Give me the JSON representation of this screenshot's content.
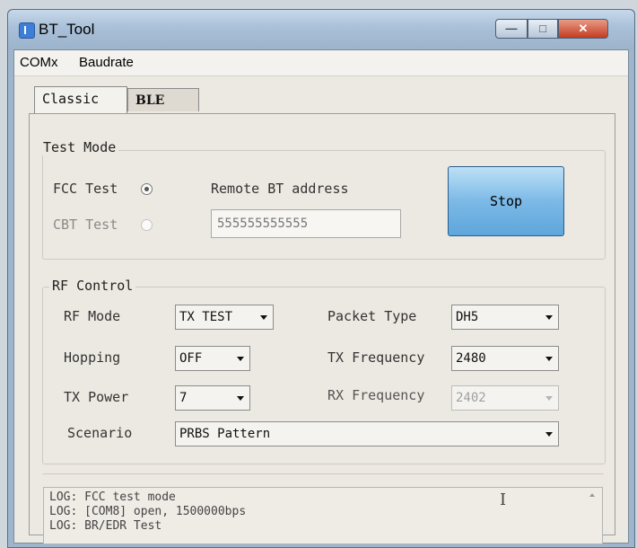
{
  "window": {
    "title": "BT_Tool"
  },
  "menu": {
    "items": [
      "COMx",
      "Baudrate"
    ]
  },
  "tabs": {
    "classic": "Classic",
    "ble": "BLE"
  },
  "test_mode": {
    "title": "Test Mode",
    "fcc_label": "FCC Test",
    "cbt_label": "CBT Test",
    "selected": "FCC Test",
    "remote_label": "Remote BT address",
    "remote_value": "555555555555",
    "stop_label": "Stop"
  },
  "rf_control": {
    "title": "RF Control",
    "rf_mode_label": "RF Mode",
    "rf_mode_value": "TX TEST",
    "packet_type_label": "Packet Type",
    "packet_type_value": "DH5",
    "hopping_label": "Hopping",
    "hopping_value": "OFF",
    "tx_freq_label": "TX Frequency",
    "tx_freq_value": "2480",
    "tx_power_label": "TX Power",
    "tx_power_value": "7",
    "rx_freq_label": "RX Frequency",
    "rx_freq_value": "2402",
    "scenario_label": "Scenario",
    "scenario_value": "PRBS Pattern"
  },
  "log": {
    "lines": [
      "LOG: FCC test mode",
      "LOG: [COM8] open, 1500000bps",
      "LOG: BR/EDR Test"
    ]
  },
  "colors": {
    "stop_button": "#7cb9e6",
    "close_button": "#c33d22"
  },
  "icons": {
    "app": "bluetooth-app-icon",
    "minimize": "minimize-icon",
    "maximize": "maximize-icon",
    "close": "close-icon"
  }
}
